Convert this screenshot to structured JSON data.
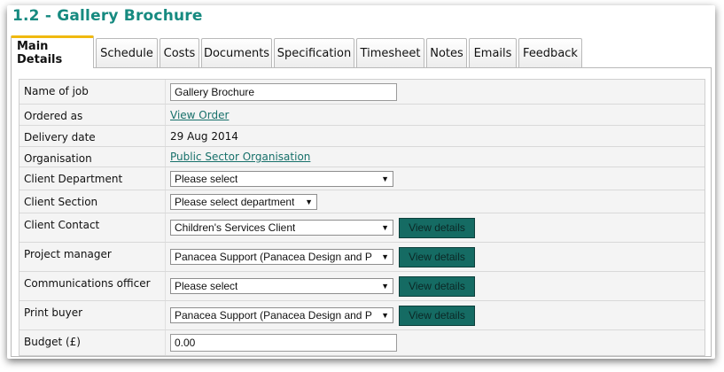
{
  "page": {
    "title": "1.2 - Gallery Brochure"
  },
  "tabs": [
    {
      "label": "Main Details",
      "active": true
    },
    {
      "label": "Schedule"
    },
    {
      "label": "Costs"
    },
    {
      "label": "Documents"
    },
    {
      "label": "Specification"
    },
    {
      "label": "Timesheet"
    },
    {
      "label": "Notes"
    },
    {
      "label": "Emails"
    },
    {
      "label": "Feedback"
    }
  ],
  "form": {
    "job_name": {
      "label": "Name of job",
      "value": "Gallery Brochure"
    },
    "ordered_as": {
      "label": "Ordered as",
      "link": "View Order"
    },
    "delivery_date": {
      "label": "Delivery date",
      "value": "29 Aug 2014"
    },
    "organisation": {
      "label": "Organisation",
      "link": "Public Sector Organisation"
    },
    "client_department": {
      "label": "Client Department",
      "selected": "Please select"
    },
    "client_section": {
      "label": "Client Section",
      "selected": "Please select department"
    },
    "client_contact": {
      "label": "Client Contact",
      "selected": "Children's Services Client",
      "button": "View details"
    },
    "project_manager": {
      "label": "Project manager",
      "selected": "Panacea Support (Panacea Design and P",
      "button": "View details"
    },
    "communications_officer": {
      "label": "Communications officer",
      "selected": "Please select",
      "button": "View details"
    },
    "print_buyer": {
      "label": "Print buyer",
      "selected": "Panacea Support (Panacea Design and P",
      "button": "View details"
    },
    "budget": {
      "label": "Budget (£)",
      "value": "0.00"
    }
  },
  "icons": {
    "dropdown": "caret-down-icon",
    "caret_glyph": "▼"
  },
  "colors": {
    "title": "#168a80",
    "active_tab_accent": "#f0b90f",
    "button": "#156b63",
    "link": "#17706a"
  }
}
